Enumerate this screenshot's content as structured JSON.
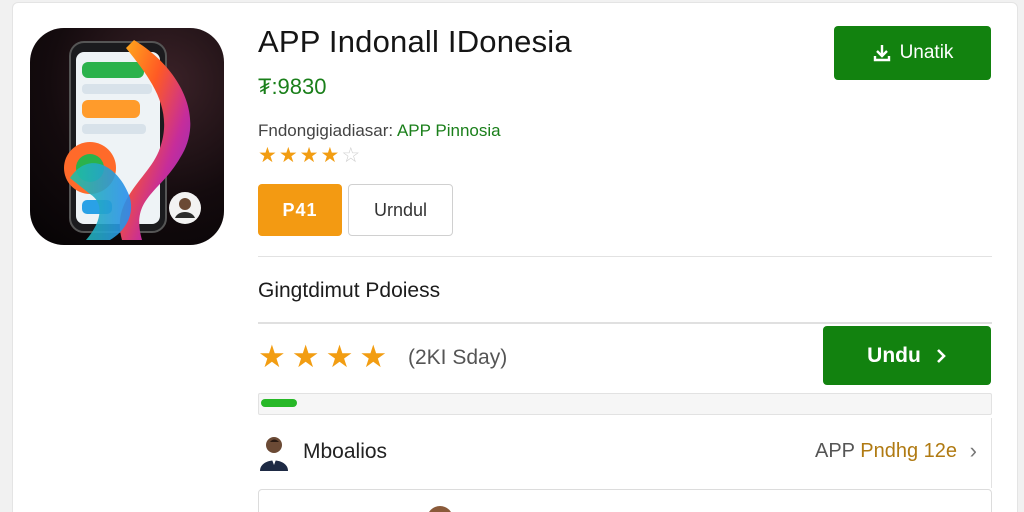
{
  "app": {
    "title": "APP Indonall IDonesia",
    "price": "₮:9830",
    "developer_label": "Fndongigiadiasar:",
    "developer_name": "APP Pinnosia",
    "rating_stars": 4,
    "rating_max": 5
  },
  "buttons": {
    "top_download_label": "Unatik",
    "orange_label": "P41",
    "outline_label": "Urndul",
    "main_download_label": "Undu"
  },
  "section": {
    "title": "Gingtdimut Pdoiess",
    "rating_stars": 4,
    "review_count": "(2KI  Sday)"
  },
  "progress": {
    "value": 0.05
  },
  "list": {
    "item_name": "Mboalios",
    "item_meta_prefix": "APP",
    "item_meta_accent": "Pndhg 12e"
  },
  "colors": {
    "accent_green": "#12820f",
    "price_green": "#1a7f1a",
    "star_orange": "#f29d12",
    "orange_button": "#f39a12"
  },
  "icons": [
    "app-icon",
    "download-icon",
    "star-icon",
    "chevron-right-icon",
    "avatar-icon"
  ]
}
